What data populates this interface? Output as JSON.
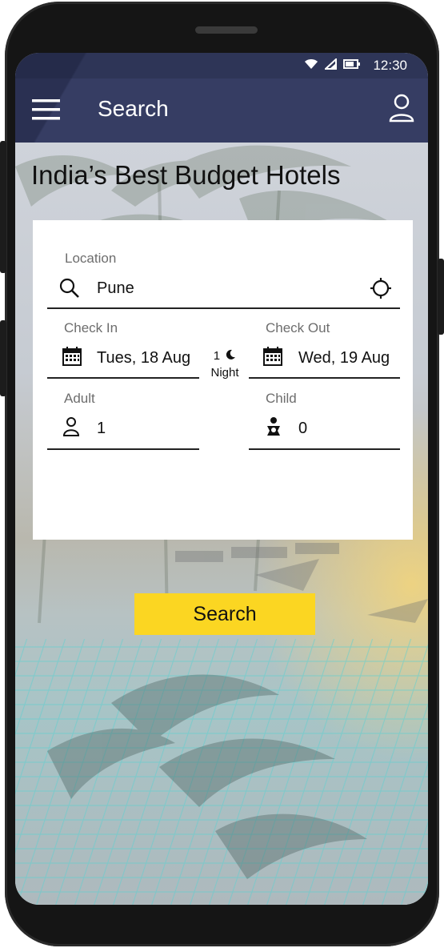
{
  "status_bar": {
    "time": "12:30",
    "icons": [
      "wifi-icon",
      "signal-icon",
      "battery-icon"
    ]
  },
  "app_bar": {
    "title": "Search",
    "menu_icon": "hamburger-menu-icon",
    "profile_icon": "user-profile-icon"
  },
  "headline": "India’s Best Budget Hotels",
  "form": {
    "location": {
      "label": "Location",
      "value": "Pune",
      "icon": "search-icon",
      "action_icon": "crosshair-location-icon"
    },
    "check_in": {
      "label": "Check In",
      "value": "Tues, 18 Aug",
      "icon": "calendar-icon"
    },
    "check_out": {
      "label": "Check Out",
      "value": "Wed, 19 Aug",
      "icon": "calendar-icon"
    },
    "nights": {
      "count": "1",
      "unit": "Night",
      "icon": "moon-icon"
    },
    "adult": {
      "label": "Adult",
      "value": "1",
      "icon": "person-icon"
    },
    "child": {
      "label": "Child",
      "value": "0",
      "icon": "child-icon"
    }
  },
  "search_button": {
    "label": "Search"
  },
  "colors": {
    "app_bar": "#363d63",
    "status_bar": "#2e3557",
    "button": "#fbd622",
    "card": "#ffffff"
  }
}
